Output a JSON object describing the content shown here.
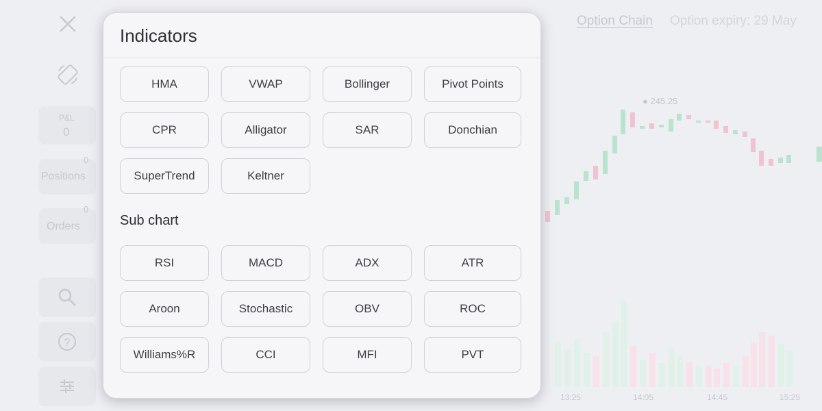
{
  "background": {
    "pnl": {
      "label": "P&L",
      "value": "0"
    },
    "positions": {
      "label": "Positions",
      "count": "0"
    },
    "orders": {
      "label": "Orders",
      "count": "0"
    },
    "header": {
      "option_chain": "Option Chain",
      "option_expiry": "Option expiry: 29 May"
    },
    "chart": {
      "price_marker": "245.25",
      "time_labels": [
        "13:25",
        "14:05",
        "14:45",
        "15:25"
      ]
    },
    "icons": [
      "close-icon",
      "rotate-screen-icon",
      "search-icon",
      "help-icon",
      "sliders-icon"
    ]
  },
  "modal": {
    "title": "Indicators",
    "overlay_items": [
      "HMA",
      "VWAP",
      "Bollinger",
      "Pivot Points",
      "CPR",
      "Alligator",
      "SAR",
      "Donchian",
      "SuperTrend",
      "Keltner"
    ],
    "subchart_title": "Sub chart",
    "subchart_items": [
      "RSI",
      "MACD",
      "ADX",
      "ATR",
      "Aroon",
      "Stochastic",
      "OBV",
      "ROC",
      "Williams%R",
      "CCI",
      "MFI",
      "PVT"
    ]
  },
  "colors": {
    "bull_candle": "#b9e3cf",
    "bear_candle": "#f1c3d0",
    "modal_bg": "#f6f6f9"
  }
}
